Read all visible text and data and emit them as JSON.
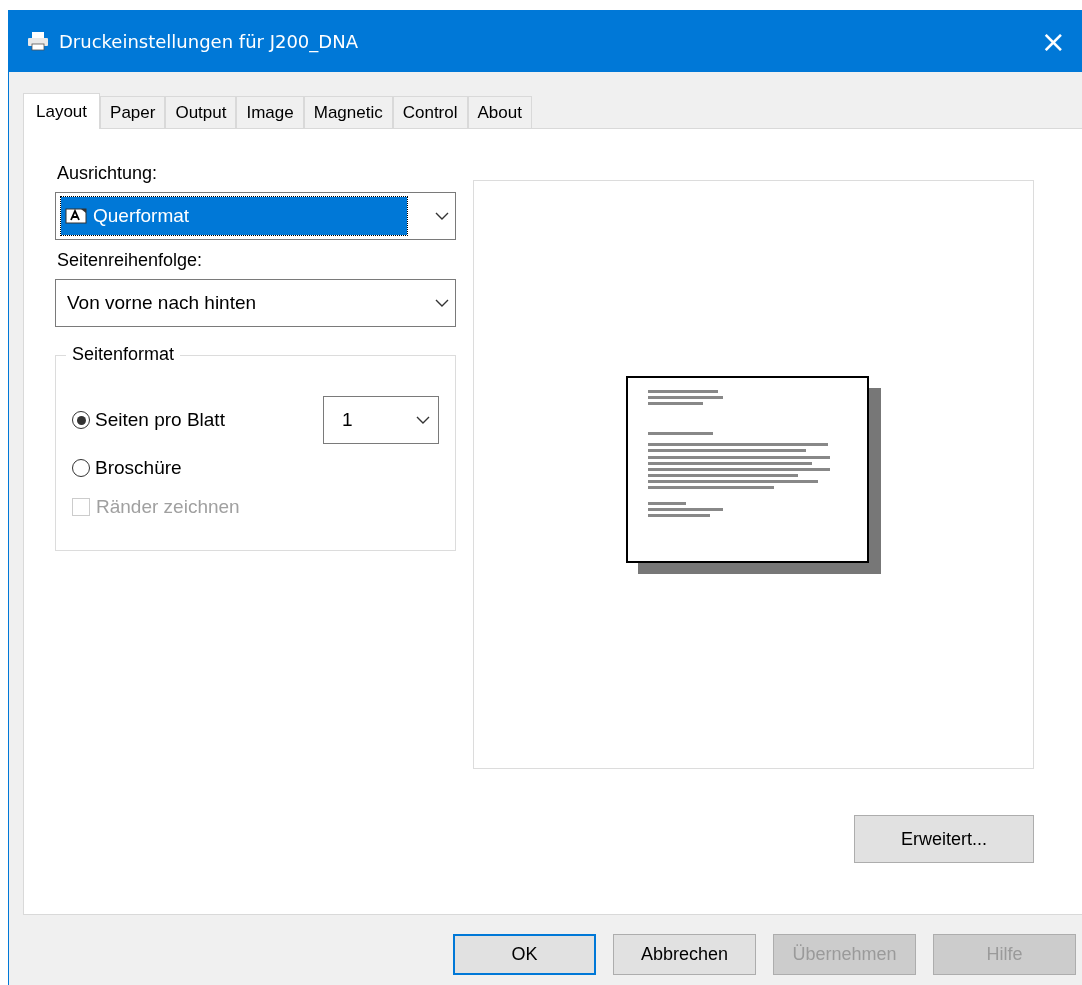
{
  "window": {
    "title": "Druckeinstellungen für J200_DNA",
    "close": "×"
  },
  "tabs": [
    {
      "label": "Layout",
      "selected": true
    },
    {
      "label": "Paper",
      "selected": false
    },
    {
      "label": "Output",
      "selected": false
    },
    {
      "label": "Image",
      "selected": false
    },
    {
      "label": "Magnetic",
      "selected": false
    },
    {
      "label": "Control",
      "selected": false
    },
    {
      "label": "About",
      "selected": false
    }
  ],
  "orientation": {
    "label": "Ausrichtung:",
    "value": "Querformat",
    "focused": true
  },
  "page_order": {
    "label": "Seitenreihenfolge:",
    "value": "Von vorne nach hinten",
    "focused": false
  },
  "page_format": {
    "title": "Seitenformat",
    "options": [
      {
        "label": "Seiten pro Blatt",
        "selected": true
      },
      {
        "label": "Broschüre",
        "selected": false
      }
    ],
    "pages_per_sheet": "1",
    "draw_borders": {
      "label": "Ränder zeichnen",
      "checked": false,
      "disabled": true
    }
  },
  "advanced_button": {
    "label": "Erweitert..."
  },
  "buttons": [
    {
      "label": "OK",
      "default": true,
      "disabled": false
    },
    {
      "label": "Abbrechen",
      "default": false,
      "disabled": false
    },
    {
      "label": "Übernehmen",
      "default": false,
      "disabled": true
    },
    {
      "label": "Hilfe",
      "default": false,
      "disabled": true
    }
  ]
}
